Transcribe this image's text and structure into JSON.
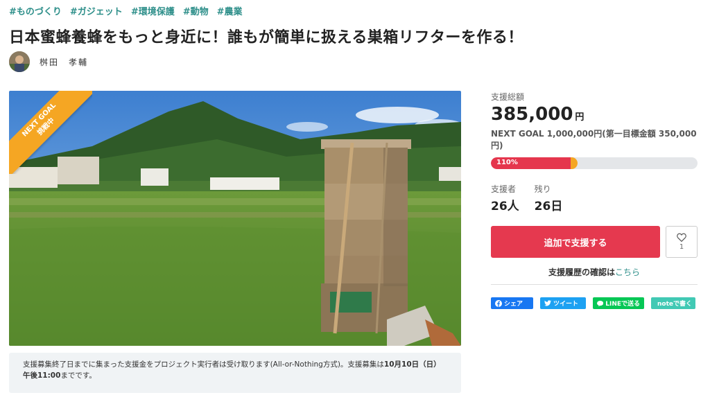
{
  "tags": [
    "#ものづくり",
    "#ガジェット",
    "#環境保護",
    "#動物",
    "#農業"
  ],
  "title": "日本蜜蜂養蜂をもっと身近に！誰もが簡単に扱える巣箱リフターを作る！",
  "owner": {
    "name": "桝田　孝輔"
  },
  "ribbon": {
    "line1": "NEXT GOAL",
    "line2": "挑戦中"
  },
  "notice": {
    "text_part1": "支援募集終了日までに集まった支援金をプロジェクト実行者は受け取ります(All-or-Nothing方式)。支援募集は",
    "text_bold": "10月10日（日）午後11:00",
    "text_part2": "までです。"
  },
  "funding": {
    "total_label": "支援総額",
    "total_amount": "385,000",
    "currency_unit": "円",
    "next_goal": "NEXT GOAL 1,000,000円(第一目標金額 350,000円)",
    "progress_text": "110%",
    "progress_fraction": 0.385,
    "progress_fraction_over": 0.035
  },
  "stats": {
    "supporters_label": "支援者",
    "supporters_value": "26人",
    "remaining_label": "残り",
    "remaining_value": "26日"
  },
  "actions": {
    "support_button": "追加で支援する",
    "favorite_count": "1",
    "history_text": "支援履歴の確認は",
    "history_link": "こちら"
  },
  "share": {
    "facebook": "シェア",
    "twitter": "ツイート",
    "line": "LINEで送る",
    "note": "noteで書く"
  },
  "colors": {
    "accent": "#e5394f",
    "tag": "#2e8f8a",
    "ribbon": "#f5a623"
  }
}
